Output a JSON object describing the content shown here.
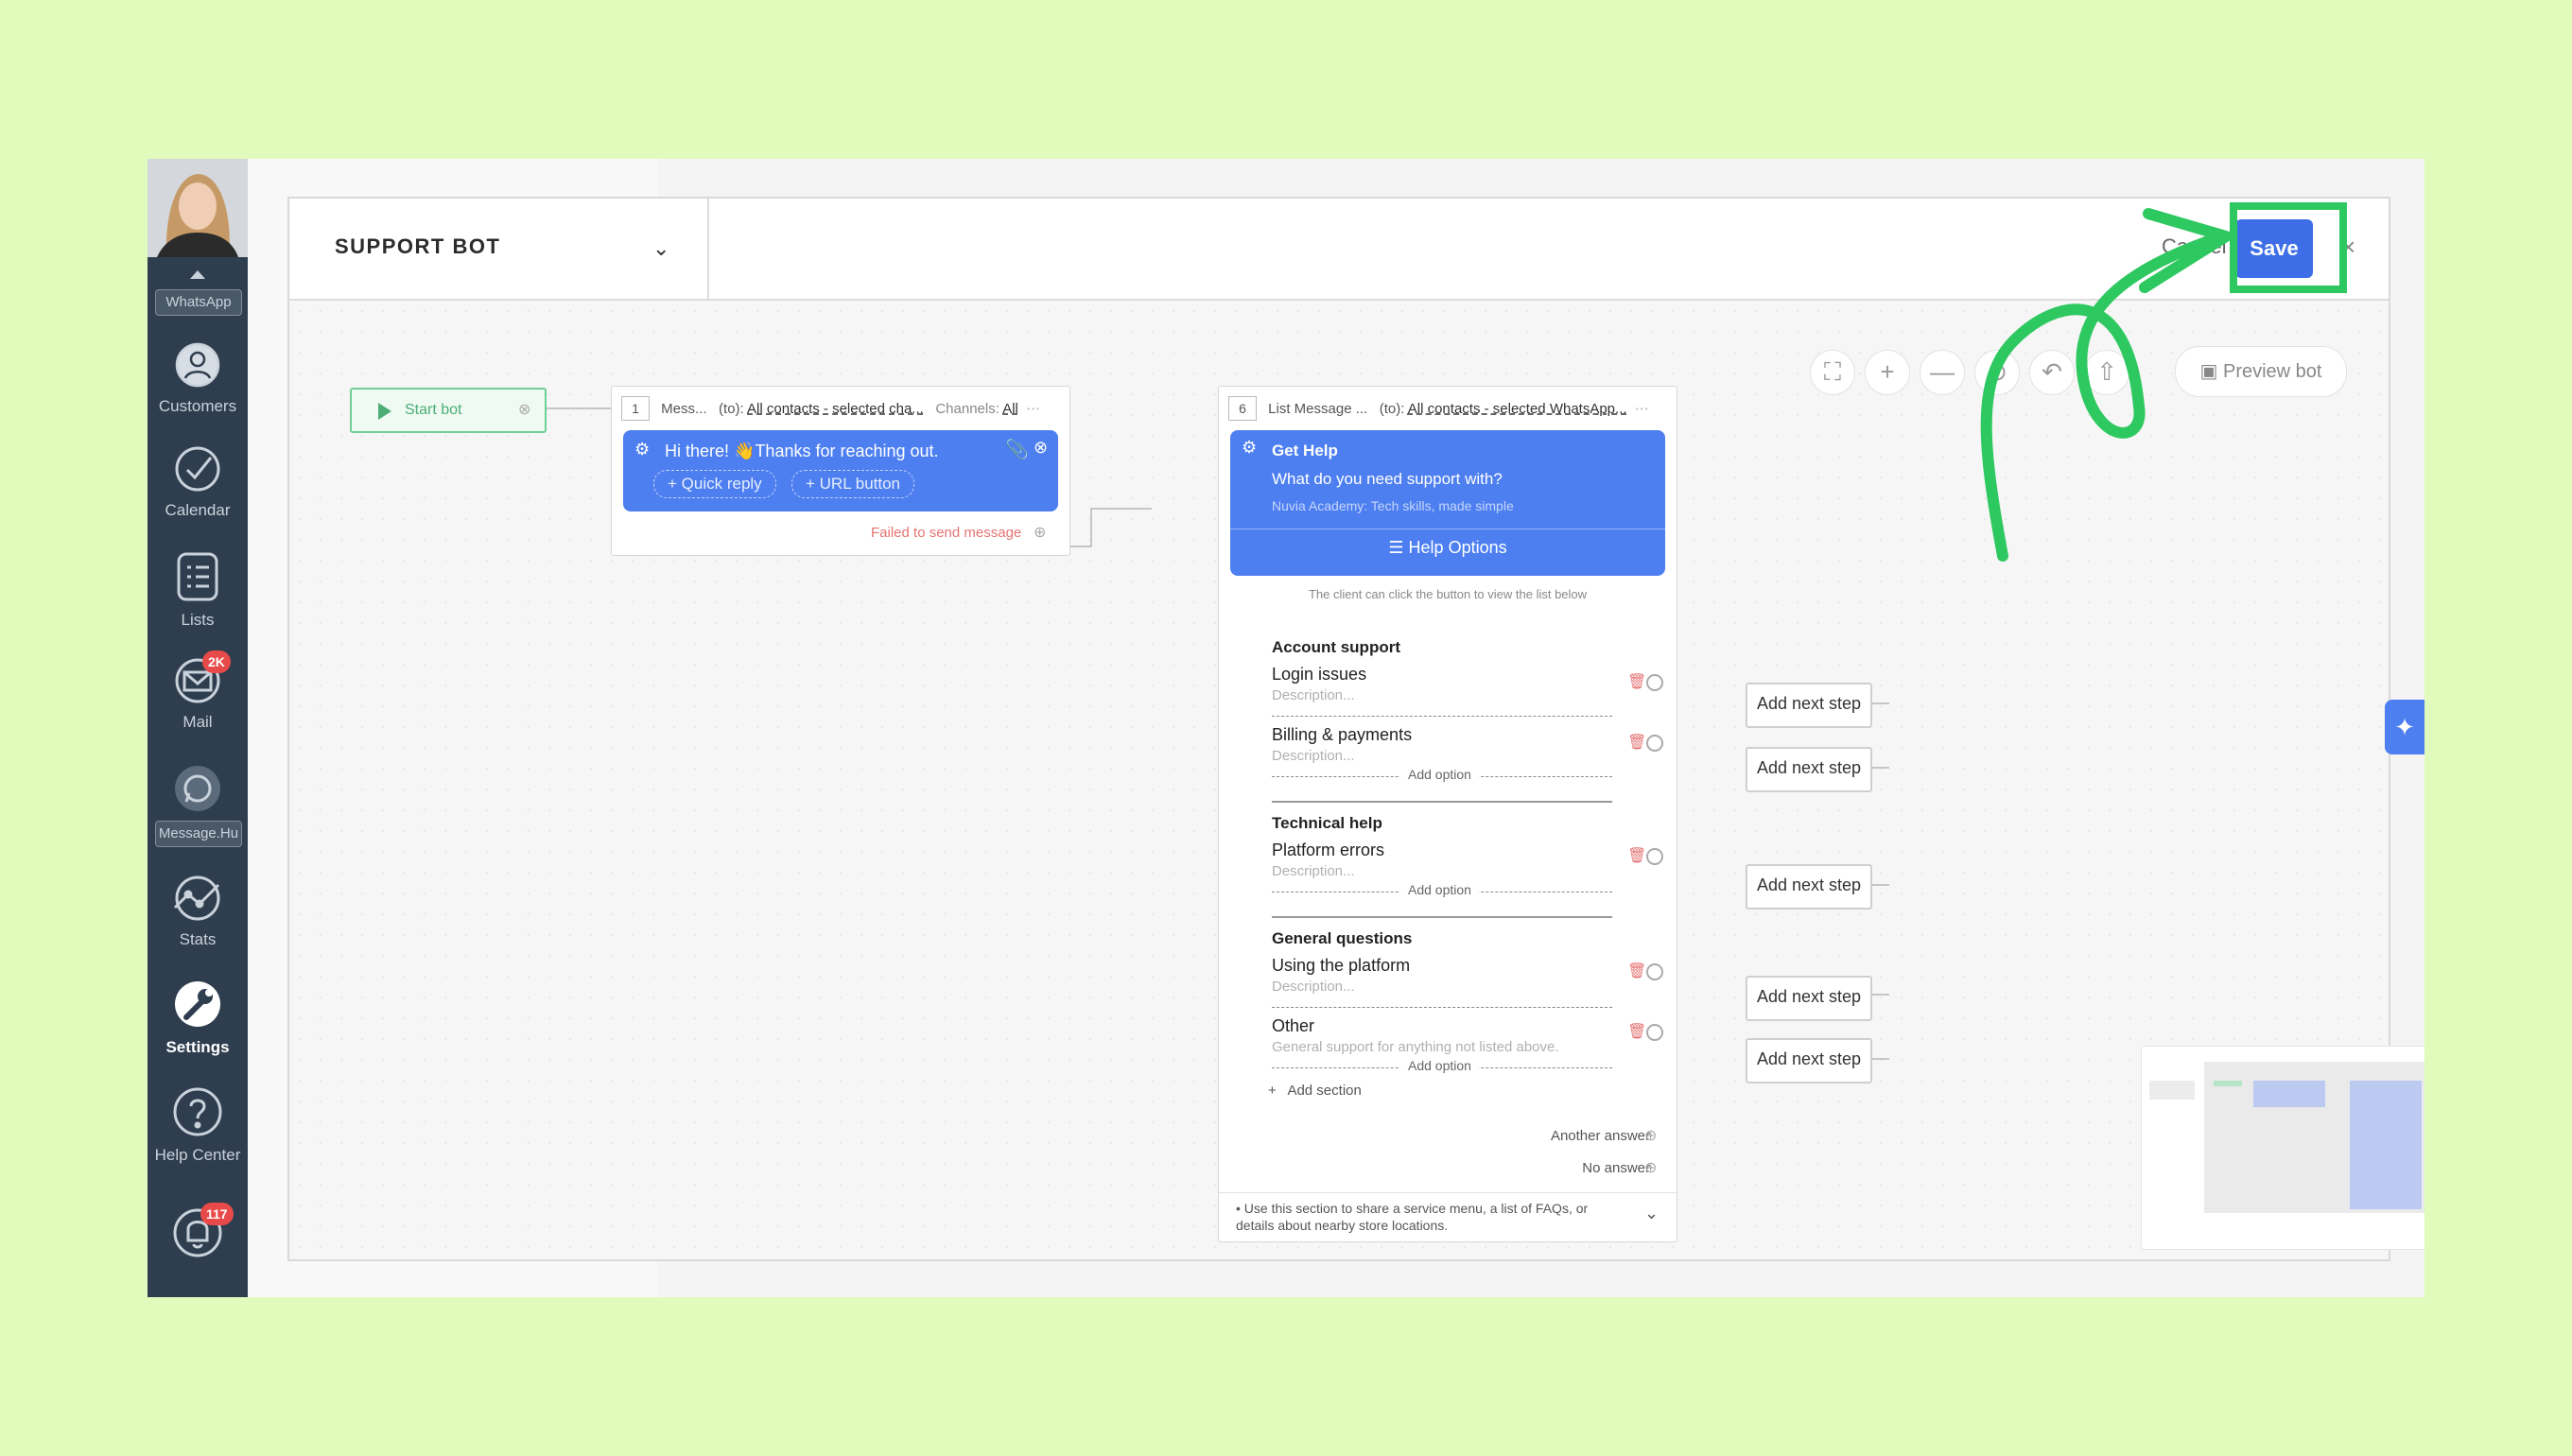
{
  "sidebar": {
    "top_chip": "WhatsApp",
    "items": [
      {
        "label": "Customers"
      },
      {
        "label": "Calendar"
      },
      {
        "label": "Lists"
      },
      {
        "label": "Mail",
        "badge": "2K"
      },
      {
        "label": "Message.Hu"
      },
      {
        "label": "Stats"
      },
      {
        "label": "Settings"
      },
      {
        "label": "Help Center"
      }
    ],
    "notifications_badge": "117"
  },
  "modal": {
    "title": "SUPPORT BOT",
    "cancel_label": "Cancel",
    "save_label": "Save",
    "close_label": "×",
    "preview_label": "Preview bot"
  },
  "start_node": {
    "label": "Start bot"
  },
  "message_node": {
    "number": "1",
    "type": "Mess...",
    "to_label": "(to):",
    "to_value": "All contacts - selected cha...",
    "channels_label": "Channels:",
    "channels_value": "All",
    "text": "Hi there! 👋Thanks for reaching out.",
    "quick_reply": "+ Quick reply",
    "url_button": "+ URL button",
    "status": "Failed to send message"
  },
  "list_node": {
    "number": "6",
    "type": "List Message ...",
    "to_label": "(to):",
    "to_value": "All contacts - selected WhatsApp...",
    "header": "Get Help",
    "body": "What do you need support with?",
    "footer": "Nuvia Academy: Tech skills, made simple",
    "button": "Help Options",
    "hint": "The client can click the button to view the list below",
    "sections": [
      {
        "title": "Account support",
        "options": [
          {
            "title": "Login issues",
            "description": "Description..."
          },
          {
            "title": "Billing & payments",
            "description": "Description..."
          }
        ]
      },
      {
        "title": "Technical help",
        "options": [
          {
            "title": "Platform errors",
            "description": "Description..."
          }
        ]
      },
      {
        "title": "General questions",
        "options": [
          {
            "title": "Using the platform",
            "description": "Description..."
          },
          {
            "title": "Other",
            "description": "General support for anything not listed above."
          }
        ]
      }
    ],
    "add_option": "Add option",
    "add_section": "Add section",
    "another_answer": "Another answer",
    "no_answer": "No answer",
    "note": "Use this section to share a service menu, a list of FAQs, or details about nearby store locations."
  },
  "next_step_label": "Add next step"
}
